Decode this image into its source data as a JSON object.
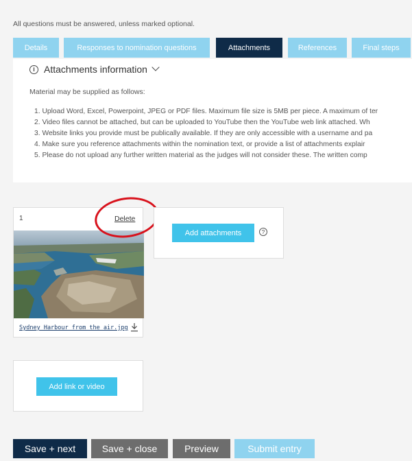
{
  "intro_text": "All questions must be answered, unless marked optional.",
  "tabs": [
    {
      "label": "Details"
    },
    {
      "label": "Responses to nomination questions"
    },
    {
      "label": "Attachments"
    },
    {
      "label": "References"
    },
    {
      "label": "Final steps"
    }
  ],
  "info": {
    "title": "Attachments information",
    "subtitle": "Material may be supplied as follows:",
    "items": [
      "1. Upload Word, Excel, Powerpoint, JPEG or PDF files. Maximum file size is 5MB per piece. A maximum of ter",
      "2. Video files cannot be attached, but can be uploaded to YouTube then the YouTube web link attached. Wh",
      "3. Website links you provide must be publically available. If they are only accessible with a username and pa",
      "4. Make sure you reference attachments within the nomination text, or provide a list of attachments explair",
      "5. Please do not upload any further written material as the judges will not consider these. The written comp"
    ]
  },
  "attachment": {
    "number": "1",
    "delete_label": "Delete",
    "filename": "Sydney Harbour from the air.jpg"
  },
  "add_attachments_label": "Add attachments",
  "help_glyph": "?",
  "add_link_label": "Add link or video",
  "footer": {
    "save_next": "Save + next",
    "save_close": "Save + close",
    "preview": "Preview",
    "submit": "Submit entry"
  },
  "icons": {
    "info": "info-icon",
    "chevron": "chevron-down-icon",
    "download": "download-icon",
    "help": "help-icon"
  },
  "colors": {
    "tab_inactive": "#8fd3ef",
    "tab_active": "#0f2b48",
    "button_blue": "#40c3ea",
    "save_next": "#0f2b48",
    "grey_button": "#6d6d6d",
    "annotation_circle": "#d8121c"
  }
}
